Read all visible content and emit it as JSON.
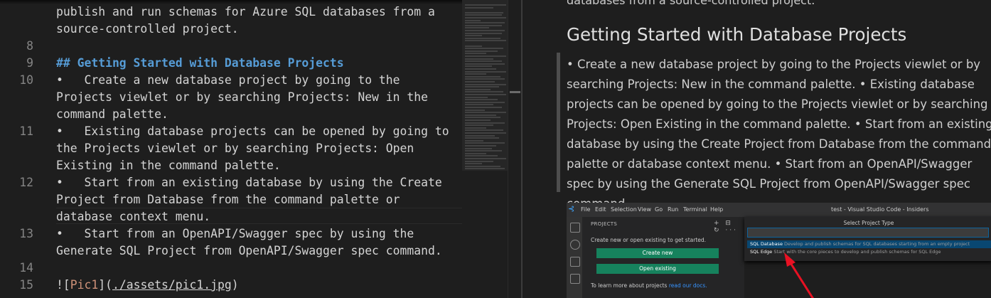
{
  "editor": {
    "lines": [
      {
        "num": "",
        "segments": [
          {
            "cls": "",
            "text": "publish and run schemas for Azure SQL databases from a"
          }
        ]
      },
      {
        "num": "",
        "segments": [
          {
            "cls": "",
            "text": "source-controlled project."
          }
        ]
      },
      {
        "num": "8",
        "segments": []
      },
      {
        "num": "9",
        "segments": [
          {
            "cls": "heading",
            "text": "## Getting Started with Database Projects"
          }
        ]
      },
      {
        "num": "10",
        "segments": [
          {
            "cls": "",
            "text": "•   Create a new database project by going to the"
          }
        ]
      },
      {
        "num": "",
        "segments": [
          {
            "cls": "",
            "text": "Projects viewlet or by searching Projects: New in the"
          }
        ]
      },
      {
        "num": "",
        "segments": [
          {
            "cls": "",
            "text": "command palette."
          }
        ]
      },
      {
        "num": "11",
        "segments": [
          {
            "cls": "",
            "text": "•   Existing database projects can be opened by going to"
          }
        ]
      },
      {
        "num": "",
        "segments": [
          {
            "cls": "",
            "text": "the Projects viewlet or by searching Projects: Open"
          }
        ]
      },
      {
        "num": "",
        "segments": [
          {
            "cls": "",
            "text": "Existing in the command palette."
          }
        ]
      },
      {
        "num": "12",
        "segments": [
          {
            "cls": "",
            "text": "•   Start from an existing database by using the Create"
          }
        ]
      },
      {
        "num": "",
        "segments": [
          {
            "cls": "",
            "text": "Project from Database from the command palette or"
          }
        ]
      },
      {
        "num": "",
        "segments": [
          {
            "cls": "",
            "text": "database context menu."
          }
        ]
      },
      {
        "num": "13",
        "segments": [
          {
            "cls": "",
            "text": "•   Start from an OpenAPI/Swagger spec by using the"
          }
        ]
      },
      {
        "num": "",
        "segments": [
          {
            "cls": "",
            "text": "Generate SQL Project from OpenAPI/Swagger spec command."
          }
        ]
      },
      {
        "num": "14",
        "segments": []
      },
      {
        "num": "15",
        "segments": [
          {
            "cls": "bang",
            "text": "!["
          },
          {
            "cls": "link-text",
            "text": "Pic1"
          },
          {
            "cls": "bang",
            "text": "]("
          },
          {
            "cls": "link-url",
            "text": "./assets/pic1.jpg"
          },
          {
            "cls": "bang",
            "text": ")"
          }
        ]
      }
    ]
  },
  "preview": {
    "intro_tail": "databases from a source-controlled project.",
    "heading": "Getting Started with Database Projects",
    "blockquote": "• Create a new database project by going to the Projects viewlet or by searching Projects: New in the command palette. • Existing database projects can be opened by going to the Projects viewlet or by searching Projects: Open Existing in the command palette. • Start from an existing database by using the Create Project from Database from the command palette or database context menu. • Start from an OpenAPI/Swagger spec by using the Generate SQL Project from OpenAPI/Swagger spec command."
  },
  "screenshot": {
    "menu": [
      "File",
      "Edit",
      "Selection",
      "View",
      "Go",
      "Run",
      "Terminal",
      "Help"
    ],
    "window_title": "test - Visual Studio Code - Insiders",
    "sidebar_title": "PROJECTS",
    "sidebar_icons": "+ ⊟ ↻ ···",
    "hint": "Create new or open existing to get started.",
    "create_button": "Create new",
    "open_button": "Open existing",
    "learn_text": "To learn more about projects",
    "learn_link": "read our docs.",
    "picker_title": "Select Project Type",
    "option1_name": "SQL Database",
    "option1_desc": "Develop and publish schemas for SQL databases starting from an empty project",
    "option2_name": "SQL Edge",
    "option2_desc": "Start with the core pieces to develop and publish schemas for SQL Edge"
  },
  "colors": {
    "background": "#1e1e1e",
    "heading": "#569cd6",
    "link_text": "#ce9178",
    "button_green": "#16825d",
    "arrow_red": "#e81123"
  }
}
